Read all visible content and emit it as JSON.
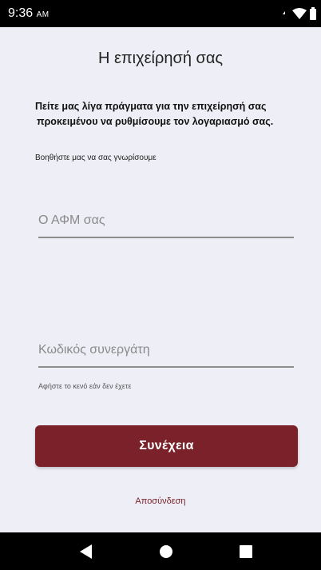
{
  "status_bar": {
    "time": "9:36",
    "ampm": "AM",
    "icons": [
      "signal-icon",
      "wifi-icon",
      "battery-icon"
    ]
  },
  "page": {
    "title": "Η επιχείρησή σας",
    "intro_line1": "Πείτε μας λίγα πράγματα για την επιχείρησή σας",
    "intro_line2": "προκειμένου να ρυθμίσουμε τον λογαριασμό σας.",
    "help_text": "Βοηθήστε μας να σας γνωρίσουμε"
  },
  "form": {
    "afm": {
      "value": "",
      "placeholder": "Ο ΑΦΜ σας"
    },
    "partner_code": {
      "value": "",
      "placeholder": "Κωδικός συνεργάτη",
      "hint": "Αφήστε το κενό εάν δεν έχετε"
    }
  },
  "actions": {
    "continue_label": "Συνέχεια",
    "logout_label": "Αποσύνδεση"
  },
  "colors": {
    "accent": "#7a2129",
    "background": "#eeeef6",
    "system_bar": "#000000"
  },
  "nav_bar": {
    "icons": [
      "back-icon",
      "home-icon",
      "recents-icon"
    ]
  }
}
